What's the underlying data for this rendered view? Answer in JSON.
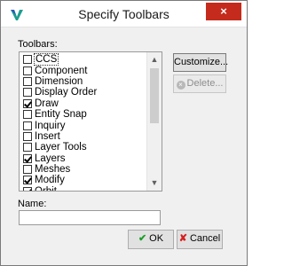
{
  "window": {
    "title": "Specify Toolbars",
    "close_glyph": "×",
    "icon": "app-logo-icon"
  },
  "toolbars": {
    "label": "Toolbars:",
    "items": [
      {
        "label": "CCS",
        "checked": false,
        "selected": true
      },
      {
        "label": "Component",
        "checked": false
      },
      {
        "label": "Dimension",
        "checked": false
      },
      {
        "label": "Display Order",
        "checked": false
      },
      {
        "label": "Draw",
        "checked": true
      },
      {
        "label": "Entity Snap",
        "checked": false
      },
      {
        "label": "Inquiry",
        "checked": false
      },
      {
        "label": "Insert",
        "checked": false
      },
      {
        "label": "Layer Tools",
        "checked": false
      },
      {
        "label": "Layers",
        "checked": true
      },
      {
        "label": "Meshes",
        "checked": false
      },
      {
        "label": "Modify",
        "checked": true
      },
      {
        "label": "Orbit",
        "checked": true
      }
    ]
  },
  "buttons": {
    "customize": "Customize...",
    "delete": "Delete...",
    "ok": "OK",
    "cancel": "Cancel"
  },
  "name": {
    "label": "Name:",
    "value": ""
  },
  "colors": {
    "close_red": "#c42b1c",
    "ok_green": "#1e9e2a",
    "cancel_red": "#d61e1e"
  }
}
